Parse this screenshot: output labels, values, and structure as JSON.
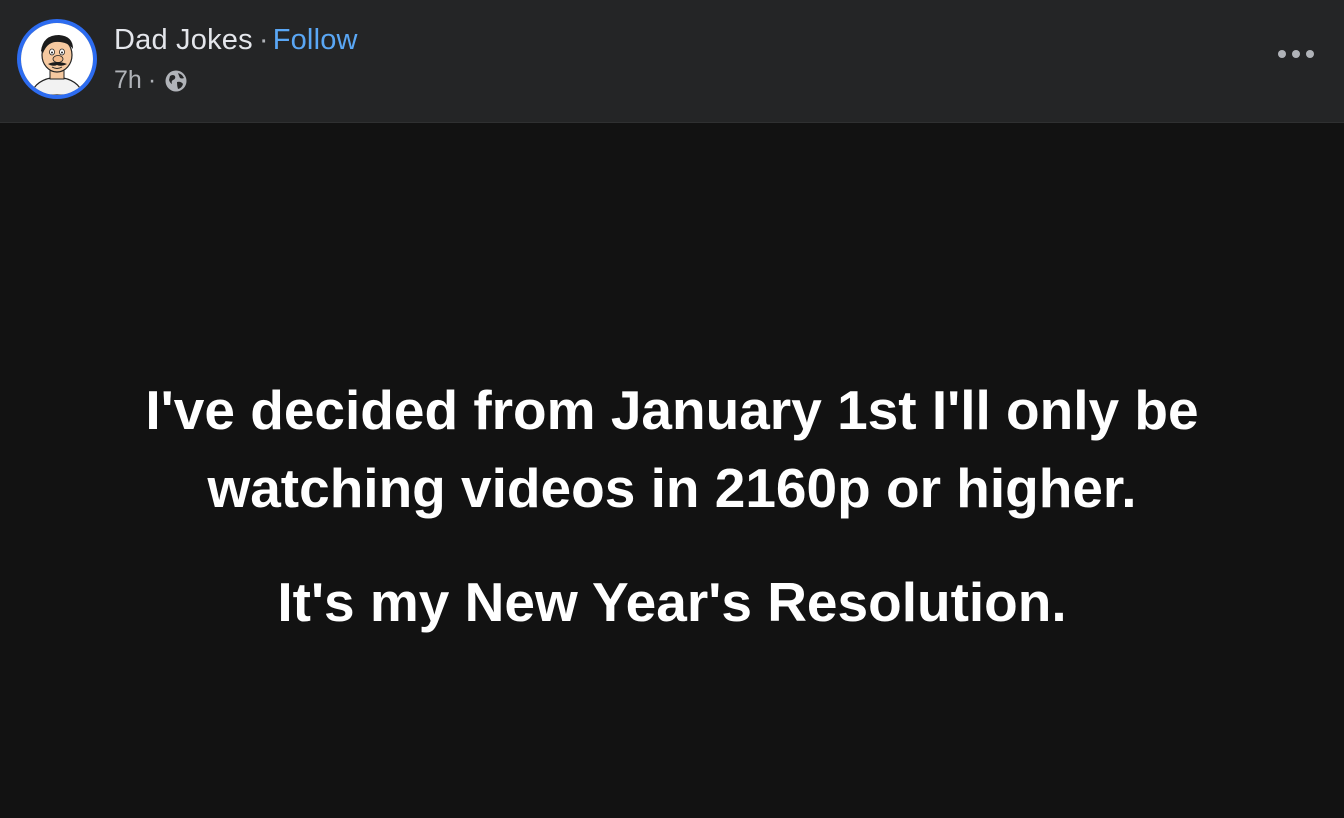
{
  "header": {
    "page_name": "Dad Jokes",
    "separator": "·",
    "follow_label": "Follow",
    "time_ago": "7h",
    "meta_separator": "·",
    "privacy_icon": "globe-icon",
    "more_icon": "more-options-icon"
  },
  "post": {
    "text_line_1": "I've decided from January 1st I'll only be",
    "text_line_2": "watching videos in 2160p or higher.",
    "text_line_3": "It's my New Year's Resolution."
  },
  "colors": {
    "header_bg": "#242526",
    "body_bg": "#121212",
    "follow_link": "#5aa7f5",
    "avatar_ring": "#2d6cf0",
    "text_primary": "#ffffff",
    "text_secondary": "#b0b3b8"
  }
}
